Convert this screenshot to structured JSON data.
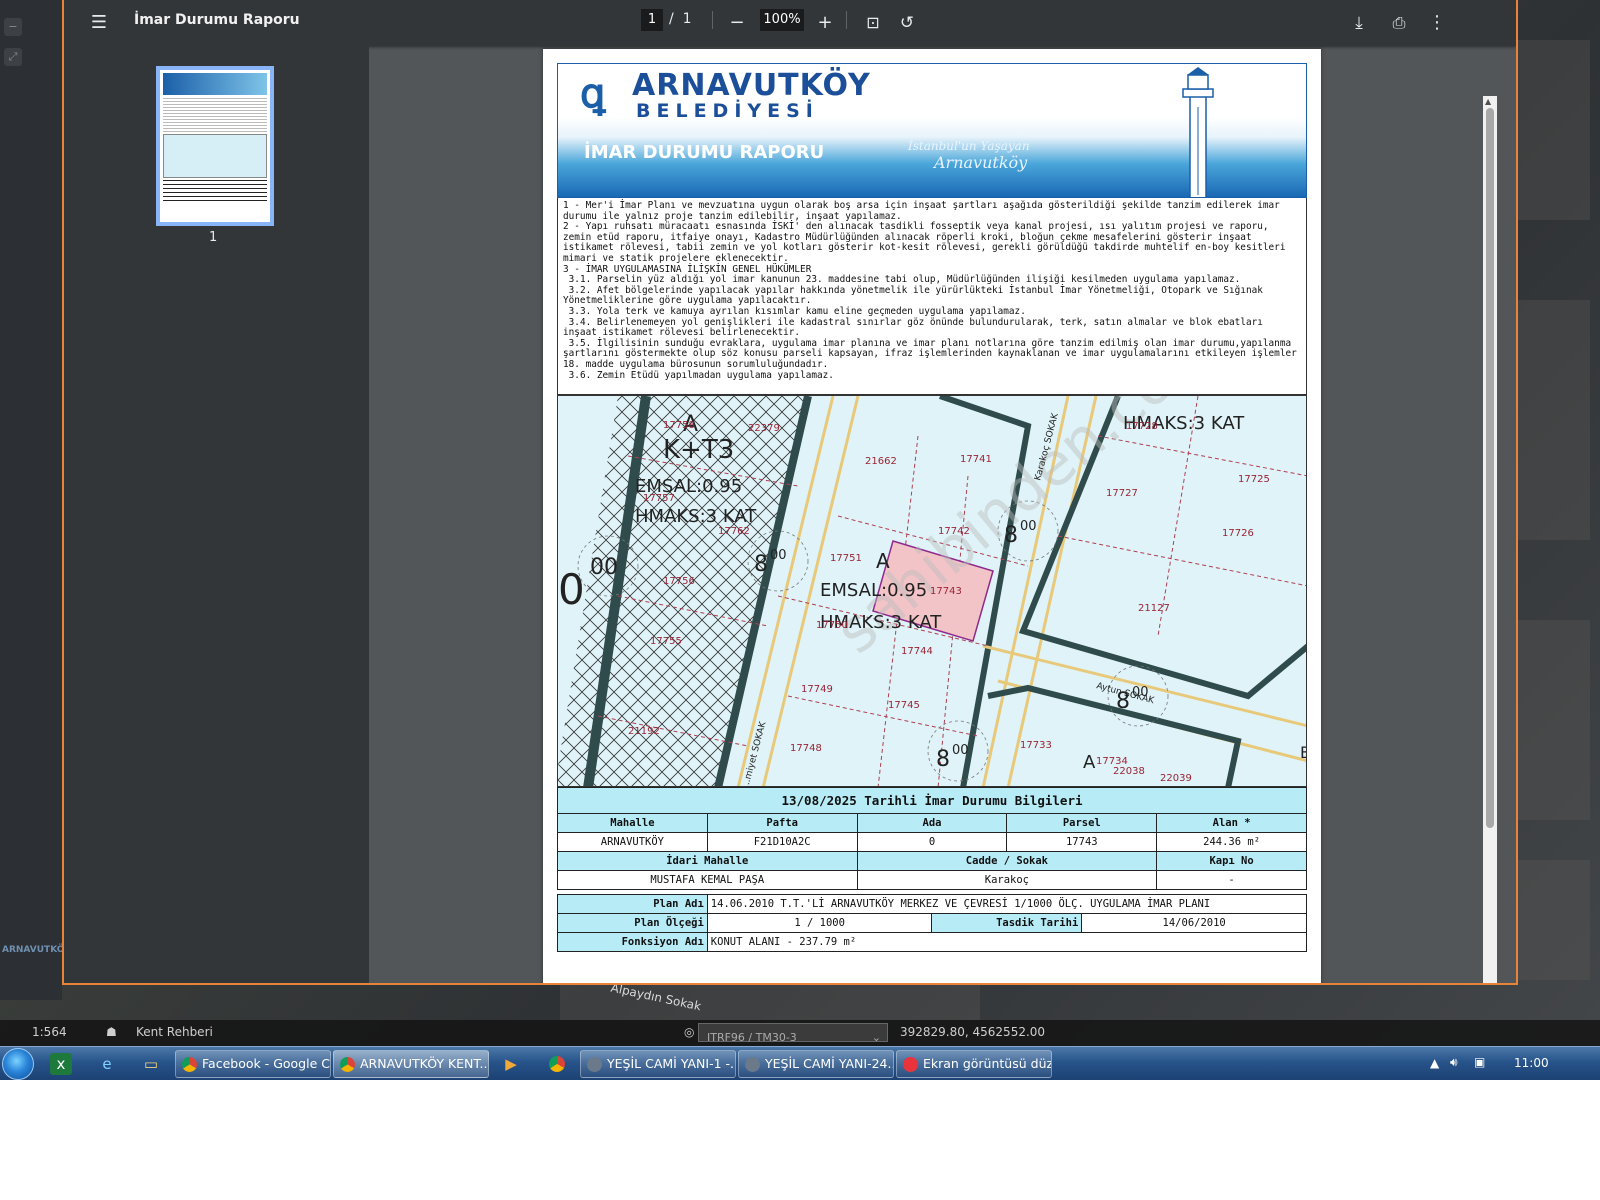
{
  "viewer": {
    "title": "İmar Durumu Raporu",
    "page_current": "1",
    "page_separator": "/",
    "page_total": "1",
    "zoom": "100%",
    "thumb_label": "1"
  },
  "report": {
    "logo_name": "ARNAVUTKÖY",
    "logo_sub": "BELEDİYESİ",
    "banner_title": "İMAR DURUMU RAPORU",
    "slogan_1": "İstanbul'un Yaşayan",
    "slogan_2": "Arnavutköy",
    "rules": "1 - Mer'i İmar Planı ve mevzuatına uygun olarak boş arsa için inşaat şartları aşağıda gösterildiği şekilde tanzim edilerek imar durumu ile yalnız proje tanzim edilebilir, inşaat yapılamaz.\n2 - Yapı ruhsatı müracaatı esnasında İSKİ' den alınacak tasdikli fosseptik veya kanal projesi, ısı yalıtım projesi ve raporu, zemin etüd raporu, itfaiye onayı, Kadastro Müdürlüğünden alınacak röperli kroki, bloğun çekme mesafelerini gösterir inşaat istikamet rölevesi, tabii zemin ve yol kotları gösterir kot-kesit rölevesi, gerekli görüldüğü takdirde muhtelif en-boy kesitleri mimari ve statik projelere eklenecektir.\n3 - İMAR UYGULAMASINA İLİŞKİN GENEL HÜKÜMLER\n 3.1. Parselin yüz aldığı yol imar kanunun 23. maddesine tabi olup, Müdürlüğünden ilişiği kesilmeden uygulama yapılamaz.\n 3.2. Afet bölgelerinde yapılacak yapılar hakkında yönetmelik ile yürürlükteki İstanbul İmar Yönetmeliği, Otopark ve Sığınak Yönetmeliklerine göre uygulama yapılacaktır.\n 3.3. Yola terk ve kamuya ayrılan kısımlar kamu eline geçmeden uygulama yapılamaz.\n 3.4. Belirlenemeyen yol genişlikleri ile kadastral sınırlar göz önünde bulundurularak, terk, satın almalar ve blok ebatları inşaat istikamet rölevesi belirlenecektir.\n 3.5. İlgilisinin sunduğu evraklara, uygulama imar planına ve imar planı notlarına göre tanzim edilmiş olan imar durumu,yapılanma şartlarını göstermekte olup söz konusu parseli kapsayan, ifraz işlemlerinden kaynaklanan ve imar uygulamalarını etkileyen işlemler 18. madde uygulama bürosunun sorumluluğundadır.\n 3.6. Zemin Etüdü yapılmadan uygulama yapılamaz."
  },
  "map": {
    "labels": {
      "zone_a_left": "A",
      "zone_kt3": "K+T3",
      "emsal_left": "EMSAL:0.95",
      "hmaks_left": "HMAKS:3 KAT",
      "zone_a_mid": "A",
      "emsal_mid": "EMSAL:0.95",
      "hmaks_mid": "HMAKS:3 KAT",
      "hmaks_right": "HMAKS:3 KAT",
      "zone_a_bottom": "A",
      "zone_b_edge": "B",
      "road_width": "8",
      "road_width_sup": "00",
      "road_left_big": "0",
      "road_left_sup": "00",
      "street_karakoc": "Karakoç SOKAK",
      "street_aytun": "Aytun SOKAK",
      "street_left": "...miyet SOKAK",
      "watermark": "sahibinden.com"
    },
    "parcels": [
      "17758",
      "22379",
      "17757",
      "17762",
      "17756",
      "17755",
      "21192",
      "21662",
      "17741",
      "17742",
      "17751",
      "17743",
      "17750",
      "17744",
      "17749",
      "17745",
      "17748",
      "17728",
      "17727",
      "17725",
      "17726",
      "21127",
      "17733",
      "17734",
      "22038",
      "22039"
    ]
  },
  "info": {
    "title": "13/08/2025 Tarihli İmar Durumu Bilgileri",
    "h_mahalle": "Mahalle",
    "h_pafta": "Pafta",
    "h_ada": "Ada",
    "h_parsel": "Parsel",
    "h_alan": "Alan *",
    "v_mahalle": "ARNAVUTKÖY",
    "v_pafta": "F21D10A2C",
    "v_ada": "0",
    "v_parsel": "17743",
    "v_alan": "244.36 m²",
    "h_idari": "İdari Mahalle",
    "h_cadde": "Cadde / Sokak",
    "h_kapi": "Kapı No",
    "v_idari": "MUSTAFA KEMAL PAŞA",
    "v_cadde": "Karakoç",
    "v_kapi": "-",
    "h_plan_adi": "Plan Adı",
    "v_plan_adi": "14.06.2010 T.T.'Lİ ARNAVUTKÖY MERKEZ VE ÇEVRESİ 1/1000 ÖLÇ. UYGULAMA İMAR PLANI",
    "h_plan_olcegi": "Plan Ölçeği",
    "v_plan_olcegi": "1 / 1000",
    "h_tasdik": "Tasdik Tarihi",
    "v_tasdik": "14/06/2010",
    "h_fonksiyon": "Fonksiyon Adı",
    "v_fonksiyon": "KONUT ALANI  - 237.79 m²"
  },
  "desktop": {
    "scale": "1:564",
    "kent_rehberi": "Kent Rehberi",
    "coord_system": "ITRF96 / TM30-3",
    "coords": "392829.80, 4562552.00",
    "street_bg": "Alpaydın Sokak",
    "bg_logo": "ARNAVUTKÖY"
  },
  "taskbar": {
    "tasks": [
      "Facebook - Google C...",
      "ARNAVUTKÖY KENT...",
      "YEŞİL CAMİ YANI-1 -...",
      "YEŞİL CAMİ YANI-24...",
      "Ekran görüntüsü düz..."
    ],
    "clock": "11:00"
  }
}
